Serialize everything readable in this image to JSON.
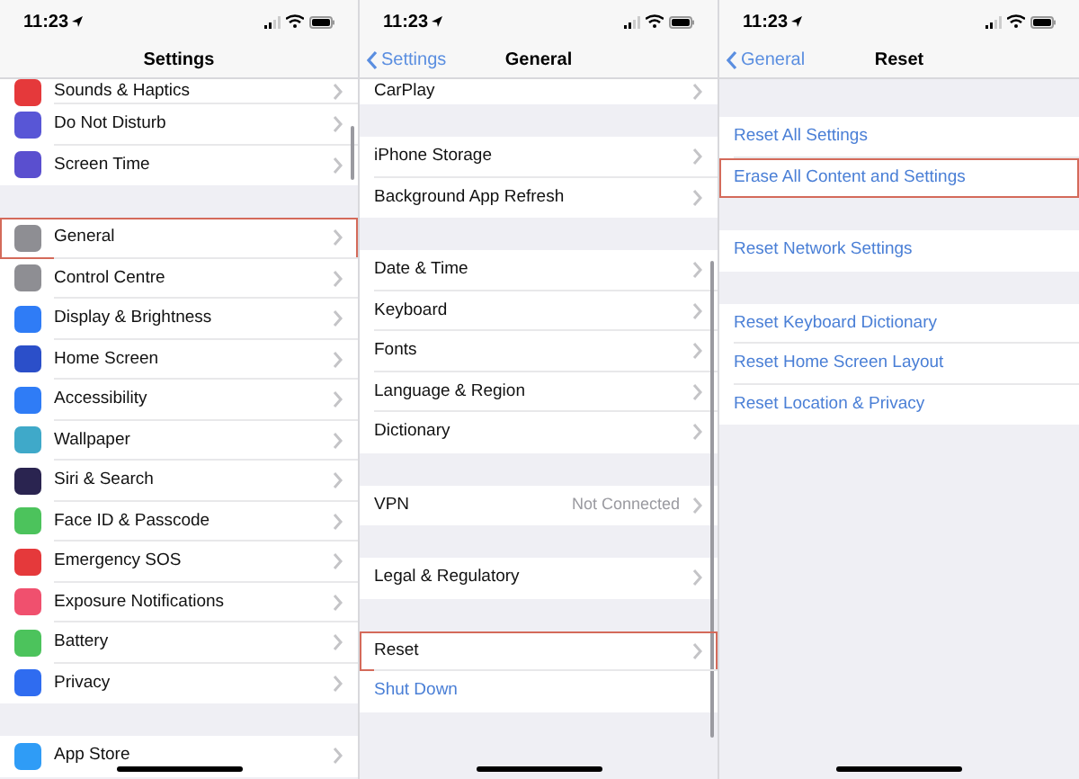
{
  "screens": [
    {
      "time": "11:23",
      "title": "Settings",
      "sections": [
        [
          {
            "kind": "nav",
            "label": "Sounds & Haptics",
            "color": "#e5393b",
            "partial": true,
            "highlighted": false
          },
          {
            "kind": "nav",
            "label": "Do Not Disturb",
            "color": "#5856d6",
            "highlighted": false
          },
          {
            "kind": "nav",
            "label": "Screen Time",
            "color": "#5a4fcf",
            "highlighted": false
          }
        ],
        [
          {
            "kind": "nav",
            "label": "General",
            "color": "#8e8e93",
            "highlighted": true
          },
          {
            "kind": "nav",
            "label": "Control Centre",
            "color": "#8e8e93",
            "highlighted": false
          },
          {
            "kind": "nav",
            "label": "Display & Brightness",
            "color": "#2f7cf6",
            "highlighted": false
          },
          {
            "kind": "nav",
            "label": "Home Screen",
            "color": "#2b4fc9",
            "highlighted": false
          },
          {
            "kind": "nav",
            "label": "Accessibility",
            "color": "#2f7cf6",
            "highlighted": false
          },
          {
            "kind": "nav",
            "label": "Wallpaper",
            "color": "#3fa9c9",
            "highlighted": false
          },
          {
            "kind": "nav",
            "label": "Siri & Search",
            "color": "#2a2450",
            "highlighted": false
          },
          {
            "kind": "nav",
            "label": "Face ID & Passcode",
            "color": "#4cc35c",
            "highlighted": false
          },
          {
            "kind": "nav",
            "label": "Emergency SOS",
            "color": "#e5393b",
            "highlighted": false
          },
          {
            "kind": "nav",
            "label": "Exposure Notifications",
            "color": "#f0506e",
            "highlighted": false
          },
          {
            "kind": "nav",
            "label": "Battery",
            "color": "#4cc35c",
            "highlighted": false
          },
          {
            "kind": "nav",
            "label": "Privacy",
            "color": "#2f6cf0",
            "highlighted": false
          }
        ],
        [
          {
            "kind": "nav",
            "label": "App Store",
            "color": "#2f9cf6",
            "highlighted": false
          }
        ]
      ]
    },
    {
      "time": "11:23",
      "back": "Settings",
      "title": "General",
      "sections": [
        [
          {
            "kind": "nav",
            "label": "CarPlay",
            "partial": true,
            "highlighted": false
          }
        ],
        [
          {
            "kind": "nav",
            "label": "iPhone Storage",
            "highlighted": false
          },
          {
            "kind": "nav",
            "label": "Background App Refresh",
            "highlighted": false
          }
        ],
        [
          {
            "kind": "nav",
            "label": "Date & Time",
            "highlighted": false
          },
          {
            "kind": "nav",
            "label": "Keyboard",
            "highlighted": false
          },
          {
            "kind": "nav",
            "label": "Fonts",
            "highlighted": false
          },
          {
            "kind": "nav",
            "label": "Language & Region",
            "highlighted": false
          },
          {
            "kind": "nav",
            "label": "Dictionary",
            "highlighted": false
          }
        ],
        [
          {
            "kind": "nav",
            "label": "VPN",
            "value": "Not Connected",
            "highlighted": false
          }
        ],
        [
          {
            "kind": "nav",
            "label": "Legal & Regulatory",
            "highlighted": false
          }
        ],
        [
          {
            "kind": "nav",
            "label": "Reset",
            "highlighted": true
          },
          {
            "kind": "action",
            "label": "Shut Down",
            "highlighted": false
          }
        ]
      ]
    },
    {
      "time": "11:23",
      "back": "General",
      "title": "Reset",
      "sections": [
        [
          {
            "kind": "action",
            "label": "Reset All Settings",
            "highlighted": false
          },
          {
            "kind": "action",
            "label": "Erase All Content and Settings",
            "highlighted": true
          }
        ],
        [
          {
            "kind": "action",
            "label": "Reset Network Settings",
            "highlighted": false
          }
        ],
        [
          {
            "kind": "action",
            "label": "Reset Keyboard Dictionary",
            "highlighted": false
          },
          {
            "kind": "action",
            "label": "Reset Home Screen Layout",
            "highlighted": false
          },
          {
            "kind": "action",
            "label": "Reset Location & Privacy",
            "highlighted": false
          }
        ]
      ]
    }
  ]
}
